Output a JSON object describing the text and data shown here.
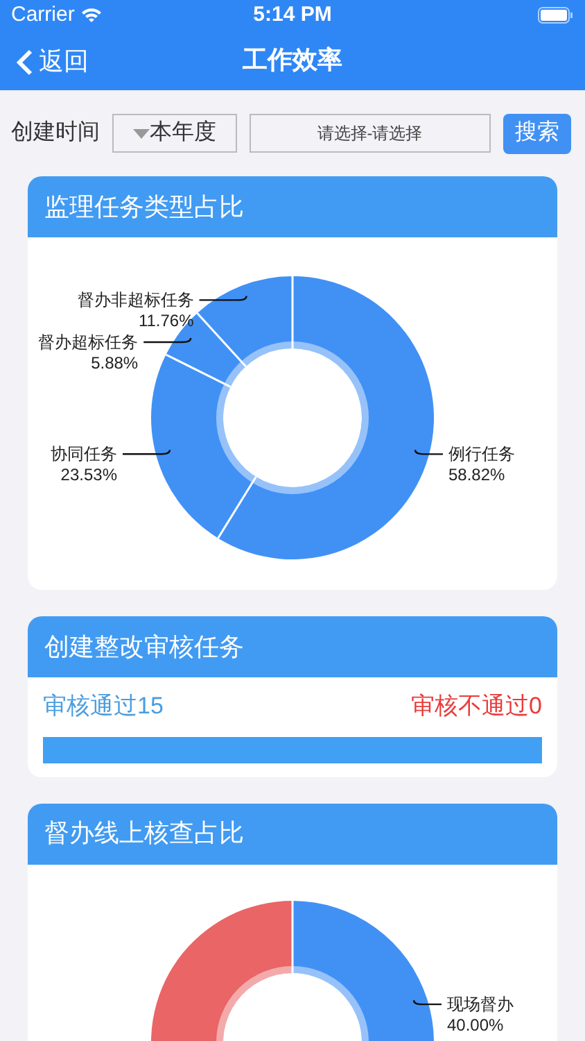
{
  "status_bar": {
    "carrier": "Carrier",
    "time": "5:14 PM"
  },
  "nav": {
    "back": "返回",
    "title": "工作效率"
  },
  "filter": {
    "label": "创建时间",
    "period": "本年度",
    "date_range": "请选择-请选择",
    "search": "搜索"
  },
  "cards": [
    {
      "kind": "donut",
      "title": "监理任务类型占比",
      "chart_data": {
        "type": "donut",
        "categories": [
          "例行任务",
          "协同任务",
          "督办超标任务",
          "督办非超标任务"
        ],
        "values": [
          58.82,
          23.53,
          5.88,
          11.76
        ],
        "colors": [
          "#4191f5",
          "#4191f5",
          "#4191f5",
          "#4191f5"
        ],
        "value_labels": [
          "58.82%",
          "23.53%",
          "5.88%",
          "11.76%"
        ]
      }
    },
    {
      "kind": "review",
      "title": "创建整改审核任务",
      "passed": "审核通过15",
      "failed": "审核不通过0",
      "level": 1
    },
    {
      "kind": "donut",
      "title": "督办线上核查占比",
      "chart_data": {
        "type": "donut",
        "categories": [
          "现场督办",
          null
        ],
        "values": [
          40,
          60
        ],
        "colors": [
          "#4191f5",
          "#ea6566"
        ],
        "value_labels": [
          "40.00%",
          null
        ]
      }
    }
  ]
}
